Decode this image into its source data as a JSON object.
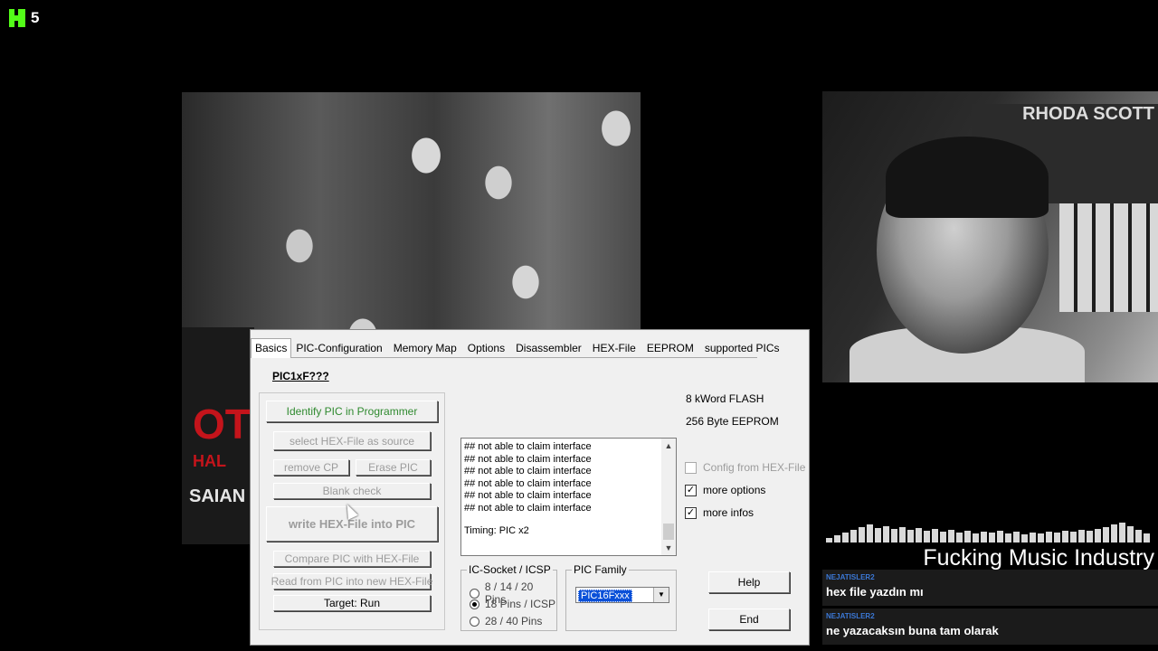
{
  "overlay": {
    "viewer_count": "5"
  },
  "album_cover": {
    "title_partial": "OT",
    "subtitle_partial": "HAL",
    "artist": "SAIAN"
  },
  "window": {
    "tabs": [
      "Basics",
      "PIC-Configuration",
      "Memory Map",
      "Options",
      "Disassembler",
      "HEX-File",
      "EEPROM",
      "supported PICs"
    ],
    "pic_title": "PIC1xF???",
    "buttons": {
      "identify": "Identify PIC in Programmer",
      "select_hex": "select HEX-File as source",
      "remove_cp": "remove CP",
      "erase_pic": "Erase PIC",
      "blank_check": "Blank check",
      "write_hex": "write HEX-File into PIC",
      "compare": "Compare PIC with HEX-File",
      "read_from_pic": "Read from PIC into new HEX-File",
      "target_run": "Target: Run",
      "help": "Help",
      "end": "End"
    },
    "info": {
      "flash": "8 kWord FLASH",
      "eeprom": "256 Byte EEPROM"
    },
    "log": {
      "lines": [
        "## not able to claim interface",
        "## not able to claim interface",
        "## not able to claim interface",
        "## not able to claim interface",
        "## not able to claim interface",
        "## not able to claim interface"
      ],
      "timing": "Timing: PIC x2"
    },
    "checkboxes": {
      "config_from_hex": {
        "label": "Config from HEX-File",
        "checked": false
      },
      "more_options": {
        "label": "more options",
        "checked": true
      },
      "more_infos": {
        "label": "more infos",
        "checked": true
      }
    },
    "ic_socket": {
      "legend": "IC-Socket / ICSP",
      "options": [
        "8 / 14 / 20 Pins",
        "18 Pins / ICSP",
        "28 / 40 Pins"
      ],
      "selected": "18 Pins / ICSP"
    },
    "pic_family": {
      "legend": "PIC Family",
      "value": "PIC16Fxxx"
    }
  },
  "music": {
    "now_playing": "Fucking Music Industry"
  },
  "chat": [
    {
      "user": "NEJATISLER2",
      "message": "hex file yazdın mı"
    },
    {
      "user": "NEJATISLER2",
      "message": "ne yazacaksın buna tam olarak"
    }
  ],
  "webcam": {
    "poster_text": "RHODA SCOTT"
  }
}
